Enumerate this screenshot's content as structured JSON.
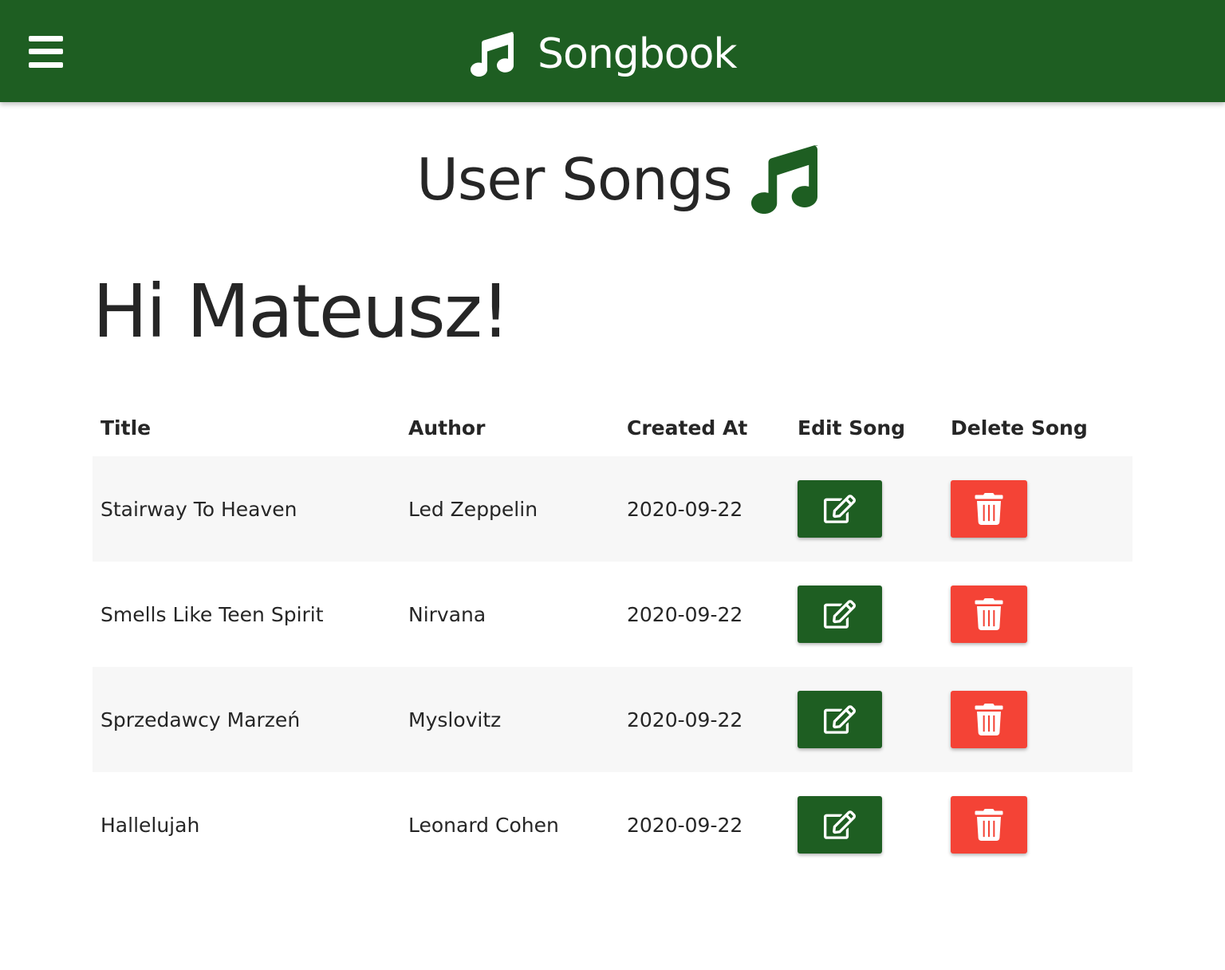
{
  "header": {
    "brand": "Songbook",
    "menu_icon": "hamburger-menu-icon",
    "brand_icon": "music-note-icon",
    "color": "#1e5e22"
  },
  "page": {
    "heading": "User Songs",
    "heading_icon": "music-note-icon",
    "greeting": "Hi Mateusz!"
  },
  "table": {
    "headers": {
      "title": "Title",
      "author": "Author",
      "created_at": "Created At",
      "edit": "Edit Song",
      "delete": "Delete Song"
    },
    "rows": [
      {
        "title": "Stairway To Heaven",
        "author": "Led Zeppelin",
        "created_at": "2020-09-22"
      },
      {
        "title": "Smells Like Teen Spirit",
        "author": "Nirvana",
        "created_at": "2020-09-22"
      },
      {
        "title": "Sprzedawcy Marzeń",
        "author": "Myslovitz",
        "created_at": "2020-09-22"
      },
      {
        "title": "Hallelujah",
        "author": "Leonard Cohen",
        "created_at": "2020-09-22"
      }
    ],
    "edit_icon": "edit-icon",
    "delete_icon": "trash-icon",
    "edit_color": "#1e5e22",
    "delete_color": "#f44336"
  }
}
